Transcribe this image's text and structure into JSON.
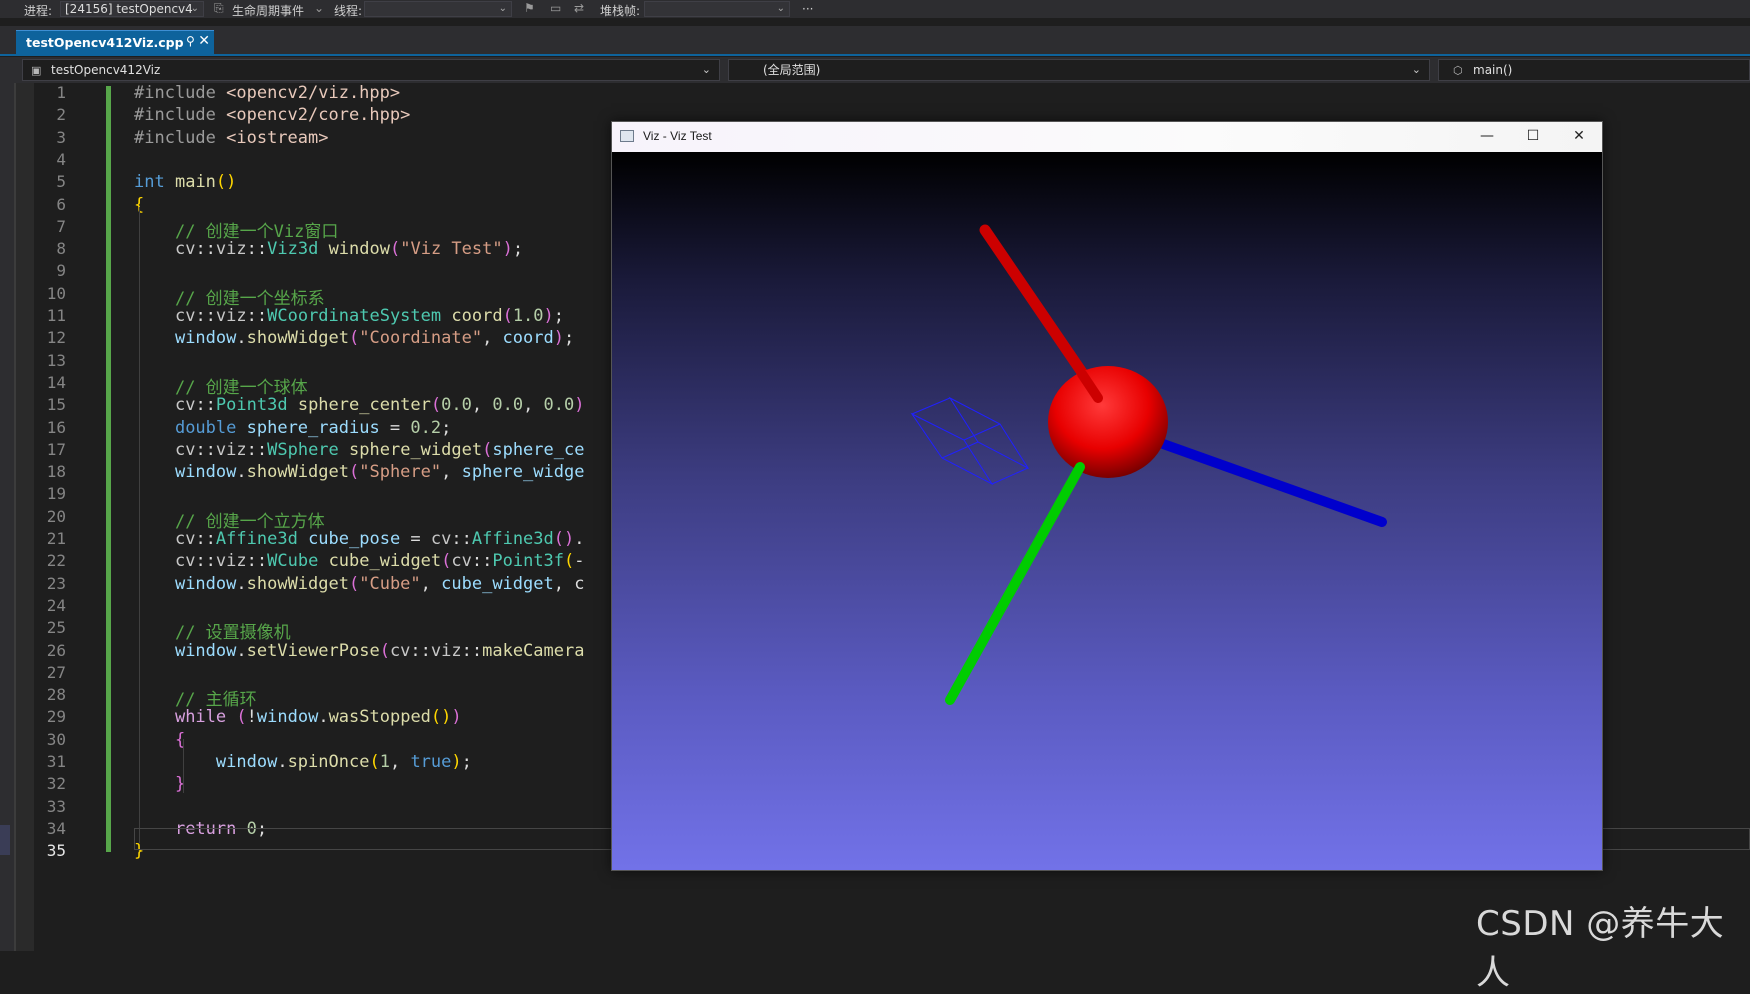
{
  "debug_toolbar": {
    "process_label": "进程:",
    "process_value": "[24156] testOpencv4",
    "lifecycle_label": "生命周期事件",
    "thread_label": "线程:",
    "thread_value": "",
    "stackframe_label": "堆栈帧:",
    "stackframe_value": "",
    "more": "···"
  },
  "tabs": [
    {
      "label": "testOpencv412Viz.cpp",
      "active": true
    }
  ],
  "navbar": {
    "project": "testOpencv412Viz",
    "scope": "(全局范围)",
    "member": "main()"
  },
  "editor": {
    "current_line": 35,
    "line_numbers": [
      "1",
      "2",
      "3",
      "4",
      "5",
      "6",
      "7",
      "8",
      "9",
      "10",
      "11",
      "12",
      "13",
      "14",
      "15",
      "16",
      "17",
      "18",
      "19",
      "20",
      "21",
      "22",
      "23",
      "24",
      "25",
      "26",
      "27",
      "28",
      "29",
      "30",
      "31",
      "32",
      "33",
      "34",
      "35"
    ],
    "lines": [
      [
        {
          "t": "#include ",
          "c": "pp"
        },
        {
          "t": "<opencv2/viz.hpp>",
          "c": "inc"
        }
      ],
      [
        {
          "t": "#include ",
          "c": "pp"
        },
        {
          "t": "<opencv2/core.hpp>",
          "c": "inc"
        }
      ],
      [
        {
          "t": "#include ",
          "c": "pp"
        },
        {
          "t": "<iostream>",
          "c": "inc"
        }
      ],
      [],
      [
        {
          "t": "int",
          "c": "kw"
        },
        {
          "t": " "
        },
        {
          "t": "main",
          "c": "fn"
        },
        {
          "t": "()",
          "c": "br1"
        }
      ],
      [
        {
          "t": "{",
          "c": "br1"
        }
      ],
      [
        {
          "t": "    "
        },
        {
          "t": "// 创建一个Viz窗口",
          "c": "com"
        }
      ],
      [
        {
          "t": "    "
        },
        {
          "t": "cv",
          "c": "ns"
        },
        {
          "t": "::"
        },
        {
          "t": "viz",
          "c": "ns"
        },
        {
          "t": "::"
        },
        {
          "t": "Viz3d",
          "c": "type"
        },
        {
          "t": " "
        },
        {
          "t": "window",
          "c": "fn"
        },
        {
          "t": "(",
          "c": "br2"
        },
        {
          "t": "\"Viz Test\"",
          "c": "str"
        },
        {
          "t": ")",
          "c": "br2"
        },
        {
          "t": ";"
        }
      ],
      [],
      [
        {
          "t": "    "
        },
        {
          "t": "// 创建一个坐标系",
          "c": "com"
        }
      ],
      [
        {
          "t": "    "
        },
        {
          "t": "cv",
          "c": "ns"
        },
        {
          "t": "::"
        },
        {
          "t": "viz",
          "c": "ns"
        },
        {
          "t": "::"
        },
        {
          "t": "WCoordinateSystem",
          "c": "type"
        },
        {
          "t": " "
        },
        {
          "t": "coord",
          "c": "fn"
        },
        {
          "t": "(",
          "c": "br2"
        },
        {
          "t": "1.0",
          "c": "num"
        },
        {
          "t": ")",
          "c": "br2"
        },
        {
          "t": ";"
        }
      ],
      [
        {
          "t": "    "
        },
        {
          "t": "window",
          "c": "var"
        },
        {
          "t": "."
        },
        {
          "t": "showWidget",
          "c": "fn"
        },
        {
          "t": "(",
          "c": "br2"
        },
        {
          "t": "\"Coordinate\"",
          "c": "str"
        },
        {
          "t": ", "
        },
        {
          "t": "coord",
          "c": "var"
        },
        {
          "t": ")",
          "c": "br2"
        },
        {
          "t": ";"
        }
      ],
      [],
      [
        {
          "t": "    "
        },
        {
          "t": "// 创建一个球体",
          "c": "com"
        }
      ],
      [
        {
          "t": "    "
        },
        {
          "t": "cv",
          "c": "ns"
        },
        {
          "t": "::"
        },
        {
          "t": "Point3d",
          "c": "type"
        },
        {
          "t": " "
        },
        {
          "t": "sphere_center",
          "c": "fn"
        },
        {
          "t": "(",
          "c": "br2"
        },
        {
          "t": "0.0",
          "c": "num"
        },
        {
          "t": ", "
        },
        {
          "t": "0.0",
          "c": "num"
        },
        {
          "t": ", "
        },
        {
          "t": "0.0",
          "c": "num"
        },
        {
          "t": ")",
          "c": "br2"
        }
      ],
      [
        {
          "t": "    "
        },
        {
          "t": "double",
          "c": "kw"
        },
        {
          "t": " "
        },
        {
          "t": "sphere_radius",
          "c": "var"
        },
        {
          "t": " = "
        },
        {
          "t": "0.2",
          "c": "num"
        },
        {
          "t": ";"
        }
      ],
      [
        {
          "t": "    "
        },
        {
          "t": "cv",
          "c": "ns"
        },
        {
          "t": "::"
        },
        {
          "t": "viz",
          "c": "ns"
        },
        {
          "t": "::"
        },
        {
          "t": "WSphere",
          "c": "type"
        },
        {
          "t": " "
        },
        {
          "t": "sphere_widget",
          "c": "fn"
        },
        {
          "t": "(",
          "c": "br2"
        },
        {
          "t": "sphere_ce",
          "c": "var"
        }
      ],
      [
        {
          "t": "    "
        },
        {
          "t": "window",
          "c": "var"
        },
        {
          "t": "."
        },
        {
          "t": "showWidget",
          "c": "fn"
        },
        {
          "t": "(",
          "c": "br2"
        },
        {
          "t": "\"Sphere\"",
          "c": "str"
        },
        {
          "t": ", "
        },
        {
          "t": "sphere_widge",
          "c": "var"
        }
      ],
      [],
      [
        {
          "t": "    "
        },
        {
          "t": "// 创建一个立方体",
          "c": "com"
        }
      ],
      [
        {
          "t": "    "
        },
        {
          "t": "cv",
          "c": "ns"
        },
        {
          "t": "::"
        },
        {
          "t": "Affine3d",
          "c": "type"
        },
        {
          "t": " "
        },
        {
          "t": "cube_pose",
          "c": "var"
        },
        {
          "t": " = "
        },
        {
          "t": "cv",
          "c": "ns"
        },
        {
          "t": "::"
        },
        {
          "t": "Affine3d",
          "c": "type"
        },
        {
          "t": "()",
          "c": "br2"
        },
        {
          "t": "."
        }
      ],
      [
        {
          "t": "    "
        },
        {
          "t": "cv",
          "c": "ns"
        },
        {
          "t": "::"
        },
        {
          "t": "viz",
          "c": "ns"
        },
        {
          "t": "::"
        },
        {
          "t": "WCube",
          "c": "type"
        },
        {
          "t": " "
        },
        {
          "t": "cube_widget",
          "c": "fn"
        },
        {
          "t": "(",
          "c": "br2"
        },
        {
          "t": "cv",
          "c": "ns"
        },
        {
          "t": "::"
        },
        {
          "t": "Point3f",
          "c": "type"
        },
        {
          "t": "(",
          "c": "br1"
        },
        {
          "t": "-"
        }
      ],
      [
        {
          "t": "    "
        },
        {
          "t": "window",
          "c": "var"
        },
        {
          "t": "."
        },
        {
          "t": "showWidget",
          "c": "fn"
        },
        {
          "t": "(",
          "c": "br2"
        },
        {
          "t": "\"Cube\"",
          "c": "str"
        },
        {
          "t": ", "
        },
        {
          "t": "cube_widget",
          "c": "var"
        },
        {
          "t": ", c"
        }
      ],
      [],
      [
        {
          "t": "    "
        },
        {
          "t": "// 设置摄像机",
          "c": "com"
        }
      ],
      [
        {
          "t": "    "
        },
        {
          "t": "window",
          "c": "var"
        },
        {
          "t": "."
        },
        {
          "t": "setViewerPose",
          "c": "fn"
        },
        {
          "t": "(",
          "c": "br2"
        },
        {
          "t": "cv",
          "c": "ns"
        },
        {
          "t": "::"
        },
        {
          "t": "viz",
          "c": "ns"
        },
        {
          "t": "::"
        },
        {
          "t": "makeCamera",
          "c": "fn"
        }
      ],
      [],
      [
        {
          "t": "    "
        },
        {
          "t": "// 主循环",
          "c": "com"
        }
      ],
      [
        {
          "t": "    "
        },
        {
          "t": "while",
          "c": "ctrl"
        },
        {
          "t": " "
        },
        {
          "t": "(",
          "c": "br2"
        },
        {
          "t": "!"
        },
        {
          "t": "window",
          "c": "var"
        },
        {
          "t": "."
        },
        {
          "t": "wasStopped",
          "c": "fn"
        },
        {
          "t": "()",
          "c": "br1"
        },
        {
          "t": ")",
          "c": "br2"
        }
      ],
      [
        {
          "t": "    "
        },
        {
          "t": "{",
          "c": "br2"
        }
      ],
      [
        {
          "t": "        "
        },
        {
          "t": "window",
          "c": "var"
        },
        {
          "t": "."
        },
        {
          "t": "spinOnce",
          "c": "fn"
        },
        {
          "t": "(",
          "c": "br1"
        },
        {
          "t": "1",
          "c": "num"
        },
        {
          "t": ", "
        },
        {
          "t": "true",
          "c": "kw"
        },
        {
          "t": ")",
          "c": "br1"
        },
        {
          "t": ";"
        }
      ],
      [
        {
          "t": "    "
        },
        {
          "t": "}",
          "c": "br2"
        }
      ],
      [],
      [
        {
          "t": "    "
        },
        {
          "t": "return",
          "c": "ctrl"
        },
        {
          "t": " "
        },
        {
          "t": "0",
          "c": "num"
        },
        {
          "t": ";"
        }
      ],
      [
        {
          "t": "}",
          "c": "br1"
        }
      ]
    ]
  },
  "viz_window": {
    "title": "Viz - Viz Test",
    "minimize_glyph": "—",
    "maximize_glyph": "☐",
    "close_glyph": "✕",
    "scene": {
      "x_axis_color": "#cc0000",
      "y_axis_color": "#00cc00",
      "z_axis_color": "#0000cc",
      "sphere_color": "#ff0000",
      "cube_wire_color": "#2020ff",
      "background_top": "#000000",
      "background_bottom": "#7272e8"
    }
  },
  "watermark": "CSDN @养牛大人"
}
